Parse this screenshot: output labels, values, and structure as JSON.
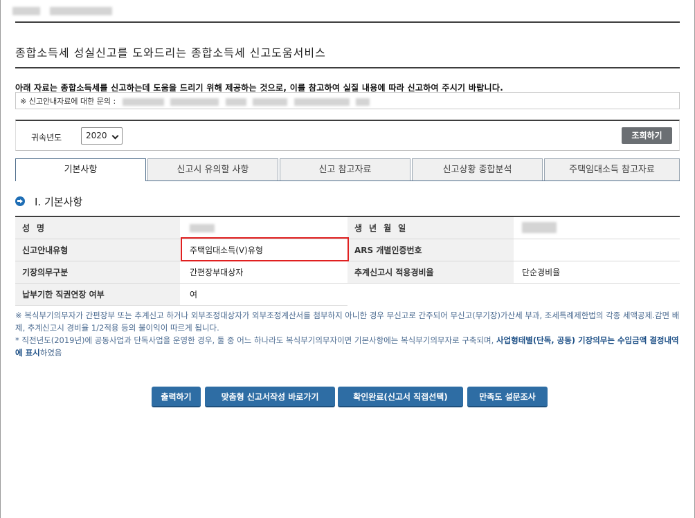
{
  "main_title": "종합소득세 성실신고를 도와드리는 종합소득세 신고도움서비스",
  "notice": "아래 자료는 종합소득세를 신고하는데 도움을 드리기 위해 제공하는 것으로, 이를 참고하여 실질 내용에 따라 신고하여 주시기 바랍니다.",
  "contact_label": "※ 신고안내자료에 대한 문의 :",
  "filter": {
    "year_label": "귀속년도",
    "year_value": "2020",
    "search_label": "조회하기"
  },
  "tabs": [
    {
      "label": "기본사항"
    },
    {
      "label": "신고시 유의할 사항"
    },
    {
      "label": "신고 참고자료"
    },
    {
      "label": "신고상황 종합분석"
    },
    {
      "label": "주택임대소득 참고자료"
    }
  ],
  "section_title": "Ⅰ. 기본사항",
  "info": {
    "name_label": "성명",
    "birth_label": "생년월일",
    "guide_type_label": "신고안내유형",
    "guide_type_value": "주택임대소득(V)유형",
    "ars_label": "ARS 개별인증번호",
    "bookkeeping_label": "기장의무구분",
    "bookkeeping_value": "간편장부대상자",
    "expense_rate_label": "추계신고시 적용경비율",
    "expense_rate_value": "단순경비율",
    "extension_label": "납부기한 직권연장 여부",
    "extension_value": "여"
  },
  "notes": {
    "line1": "※ 복식부기의무자가 간편장부 또는 추계신고 하거나 외부조정대상자가 외부조정계산서를 첨부하지 아니한 경우 무신고로 간주되어 무신고(무기장)가산세 부과, 조세특례제한법의 각종 세액공제.감면 배제, 추계신고시 경비율 1/2적용 등의 불이익이 따르게 됩니다.",
    "line2_prefix": "* 직전년도(2019년)에 공동사업과 단독사업을 운영한 경우, 둘 중 어느 하나라도 복식부기의무자이면 기본사항에는 복식부기의무자로 구축되며, ",
    "line2_strong": "사업형태별(단독, 공동) 기장의무는 수입금액 결정내역에 표시",
    "line2_suffix": "하였음"
  },
  "buttons": {
    "print": "출력하기",
    "custom_form": "맞춤형 신고서작성 바로가기",
    "confirm": "확인완료(신고서 직접선택)",
    "survey": "만족도 설문조사"
  }
}
